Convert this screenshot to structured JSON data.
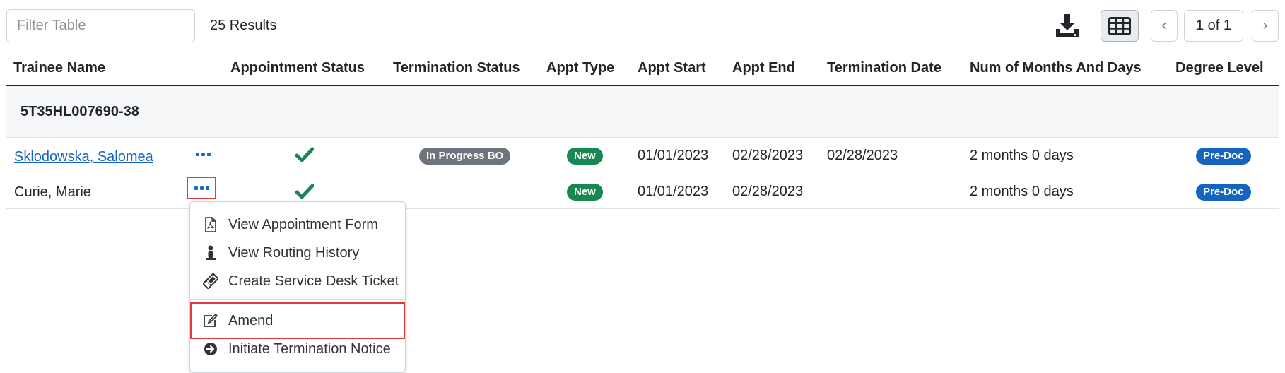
{
  "toolbar": {
    "filter_placeholder": "Filter Table",
    "results_text": "25 Results",
    "page_label": "1 of 1",
    "prev_symbol": "‹",
    "next_symbol": "›"
  },
  "columns": [
    "Trainee Name",
    "Appointment Status",
    "Termination Status",
    "Appt Type",
    "Appt Start",
    "Appt End",
    "Termination Date",
    "Num of Months And Days",
    "Degree Level"
  ],
  "group": {
    "label": "5T35HL007690-38"
  },
  "rows": [
    {
      "trainee_name": "Sklodowska, Salomea",
      "termination_status": "In Progress BO",
      "appt_type": "New",
      "appt_start": "01/01/2023",
      "appt_end": "02/28/2023",
      "termination_date": "02/28/2023",
      "months_days": "2 months 0 days",
      "degree_level": "Pre-Doc"
    },
    {
      "trainee_name": "Curie, Marie",
      "termination_status": "",
      "appt_type": "New",
      "appt_start": "01/01/2023",
      "appt_end": "02/28/2023",
      "termination_date": "",
      "months_days": "2 months 0 days",
      "degree_level": "Pre-Doc"
    }
  ],
  "menu": {
    "items": [
      {
        "label": "View Appointment Form",
        "icon": "pdf-file-icon"
      },
      {
        "label": "View Routing History",
        "icon": "person-icon"
      },
      {
        "label": "Create Service Desk Ticket",
        "icon": "ticket-icon"
      },
      {
        "label": "Amend",
        "icon": "edit-icon"
      },
      {
        "label": "Initiate Termination Notice",
        "icon": "arrow-circle-right-icon"
      }
    ]
  },
  "colors": {
    "link": "#1565c0",
    "check": "#198754",
    "badge_gray": "#6c757d",
    "badge_green": "#198754",
    "badge_blue": "#1565c0",
    "highlight": "#e0393e"
  }
}
